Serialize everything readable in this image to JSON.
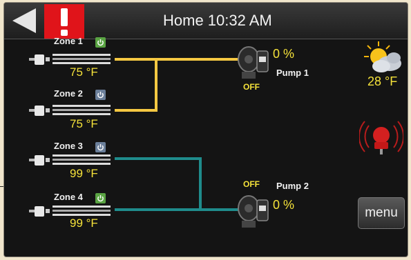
{
  "header": {
    "title": "Home  10:32 AM",
    "back_icon": "back-arrow-icon",
    "alert_icon": "exclamation-icon",
    "alert_color": "#e0141a"
  },
  "zones": [
    {
      "label": "Zone 1",
      "temp": "75 °F",
      "power": "on"
    },
    {
      "label": "Zone 2",
      "temp": "75 °F",
      "power": "off"
    },
    {
      "label": "Zone 3",
      "temp": "99 °F",
      "power": "off"
    },
    {
      "label": "Zone 4",
      "temp": "99 °F",
      "power": "on"
    }
  ],
  "pumps": [
    {
      "label": "Pump 1",
      "percent": "0 %",
      "state": "OFF"
    },
    {
      "label": "Pump 2",
      "percent": "0 %",
      "state": "OFF"
    }
  ],
  "weather": {
    "temp": "28 °F",
    "icon": "partly-cloudy-icon"
  },
  "alarm": {
    "icon": "alarm-bell-icon"
  },
  "menu": {
    "label": "menu"
  },
  "colors": {
    "pump1_pipe": "#f5c842",
    "pump2_pipe": "#1f8c8c",
    "value_text": "#f5e23a",
    "power_on": "#5aa443",
    "power_off": "#6b7f9a"
  }
}
